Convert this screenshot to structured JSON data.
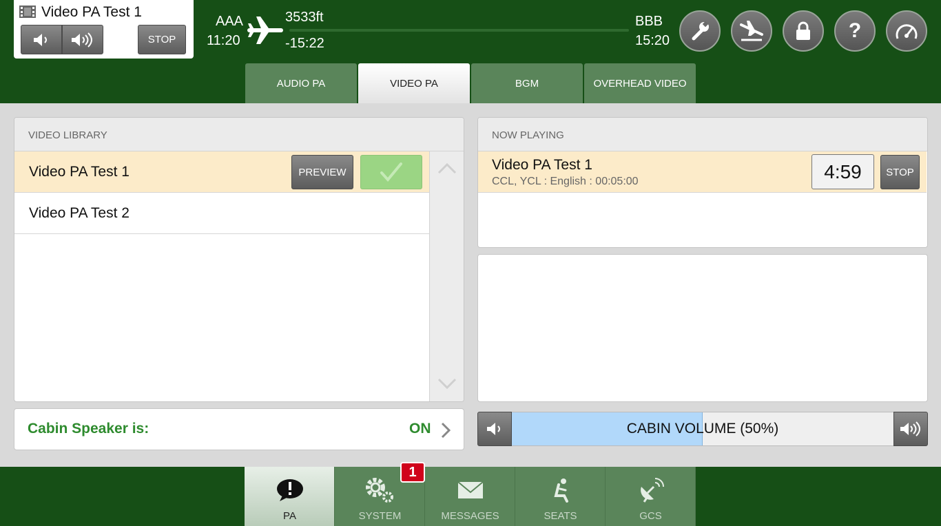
{
  "now_playing_card": {
    "title": "Video PA Test 1",
    "stop_label": "STOP"
  },
  "flight": {
    "origin": "AAA",
    "origin_time": "11:20",
    "destination": "BBB",
    "destination_time": "15:20",
    "altitude": "3533ft",
    "remaining": "-15:22"
  },
  "tabs": [
    {
      "label": "AUDIO PA"
    },
    {
      "label": "VIDEO PA"
    },
    {
      "label": "BGM"
    },
    {
      "label": "OVERHEAD VIDEO"
    }
  ],
  "library": {
    "header": "VIDEO LIBRARY",
    "items": [
      {
        "label": "Video PA Test 1"
      },
      {
        "label": "Video PA Test 2"
      }
    ],
    "preview_label": "PREVIEW"
  },
  "now_playing": {
    "header": "NOW PLAYING",
    "title": "Video PA Test 1",
    "subtitle": "CCL, YCL : English : 00:05:00",
    "countdown": "4:59",
    "stop_label": "STOP"
  },
  "cabin_speaker": {
    "label": "Cabin Speaker is:",
    "value": "ON"
  },
  "cabin_volume": {
    "label": "CABIN VOLUME (50%)",
    "level": 0.5
  },
  "bottom_nav": [
    {
      "label": "PA",
      "icon": "pa-speech-icon"
    },
    {
      "label": "SYSTEM",
      "icon": "gears-icon"
    },
    {
      "label": "MESSAGES",
      "icon": "envelope-icon"
    },
    {
      "label": "SEATS",
      "icon": "seat-icon"
    },
    {
      "label": "GCS",
      "icon": "satellite-dish-icon"
    }
  ],
  "system_badge": "1",
  "colors": {
    "header_green": "#164f16",
    "tab_green": "#5a855a",
    "selected_row": "#fcebc9",
    "accent_text": "#2e8b2e",
    "volume_fill": "#b1d8fa",
    "badge_red": "#d0021b"
  }
}
